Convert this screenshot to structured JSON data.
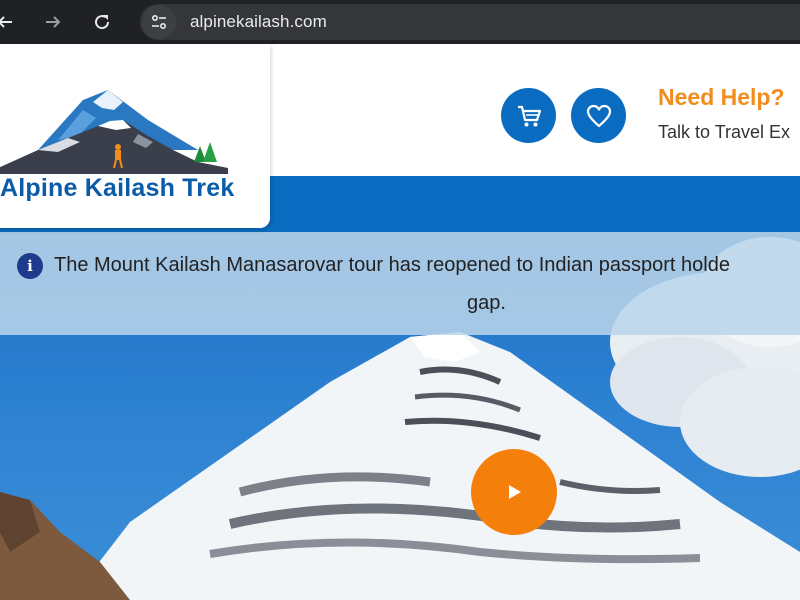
{
  "browser": {
    "url": "alpinekailash.com",
    "icons": {
      "back": "arrow-left-icon",
      "forward": "arrow-right-icon",
      "reload": "reload-icon",
      "site_info": "tune-icon"
    }
  },
  "header": {
    "logo_text": "Alpine Kailash Trek",
    "help_title": "Need Help?",
    "help_subtitle": "Talk to Travel Ex",
    "icons": {
      "cart": "cart-icon",
      "wishlist": "heart-icon"
    }
  },
  "notice": {
    "line1": "The Mount Kailash Manasarovar tour has reopened to Indian passport holde",
    "line2": "gap."
  },
  "hero": {
    "play_icon": "play-icon"
  },
  "colors": {
    "brand_blue": "#0a6cc0",
    "accent_orange": "#f47f0a",
    "help_orange": "#f28c1c",
    "notice_bg": "#bad5ea"
  }
}
